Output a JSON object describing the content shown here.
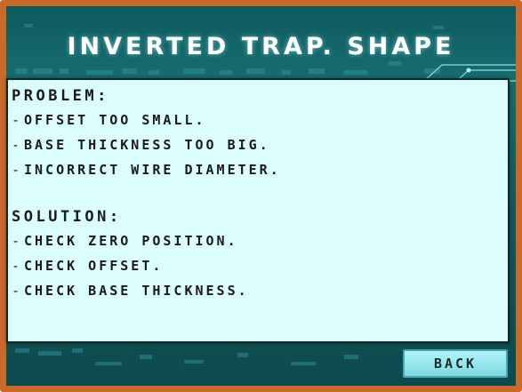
{
  "screen": {
    "title": "INVERTED TRAP. SHAPE",
    "accent_color": "#c9692a",
    "panel_color": "#dcfdfd"
  },
  "problem": {
    "heading": "PROBLEM:",
    "items": [
      "Offset too small.",
      "Base thickness too big.",
      "Incorrect wire diameter."
    ]
  },
  "solution": {
    "heading": "SOLUTION:",
    "items": [
      "Check Zero Position.",
      "Check offset.",
      "Check base thickness."
    ]
  },
  "footer": {
    "back_label": "BACK"
  }
}
